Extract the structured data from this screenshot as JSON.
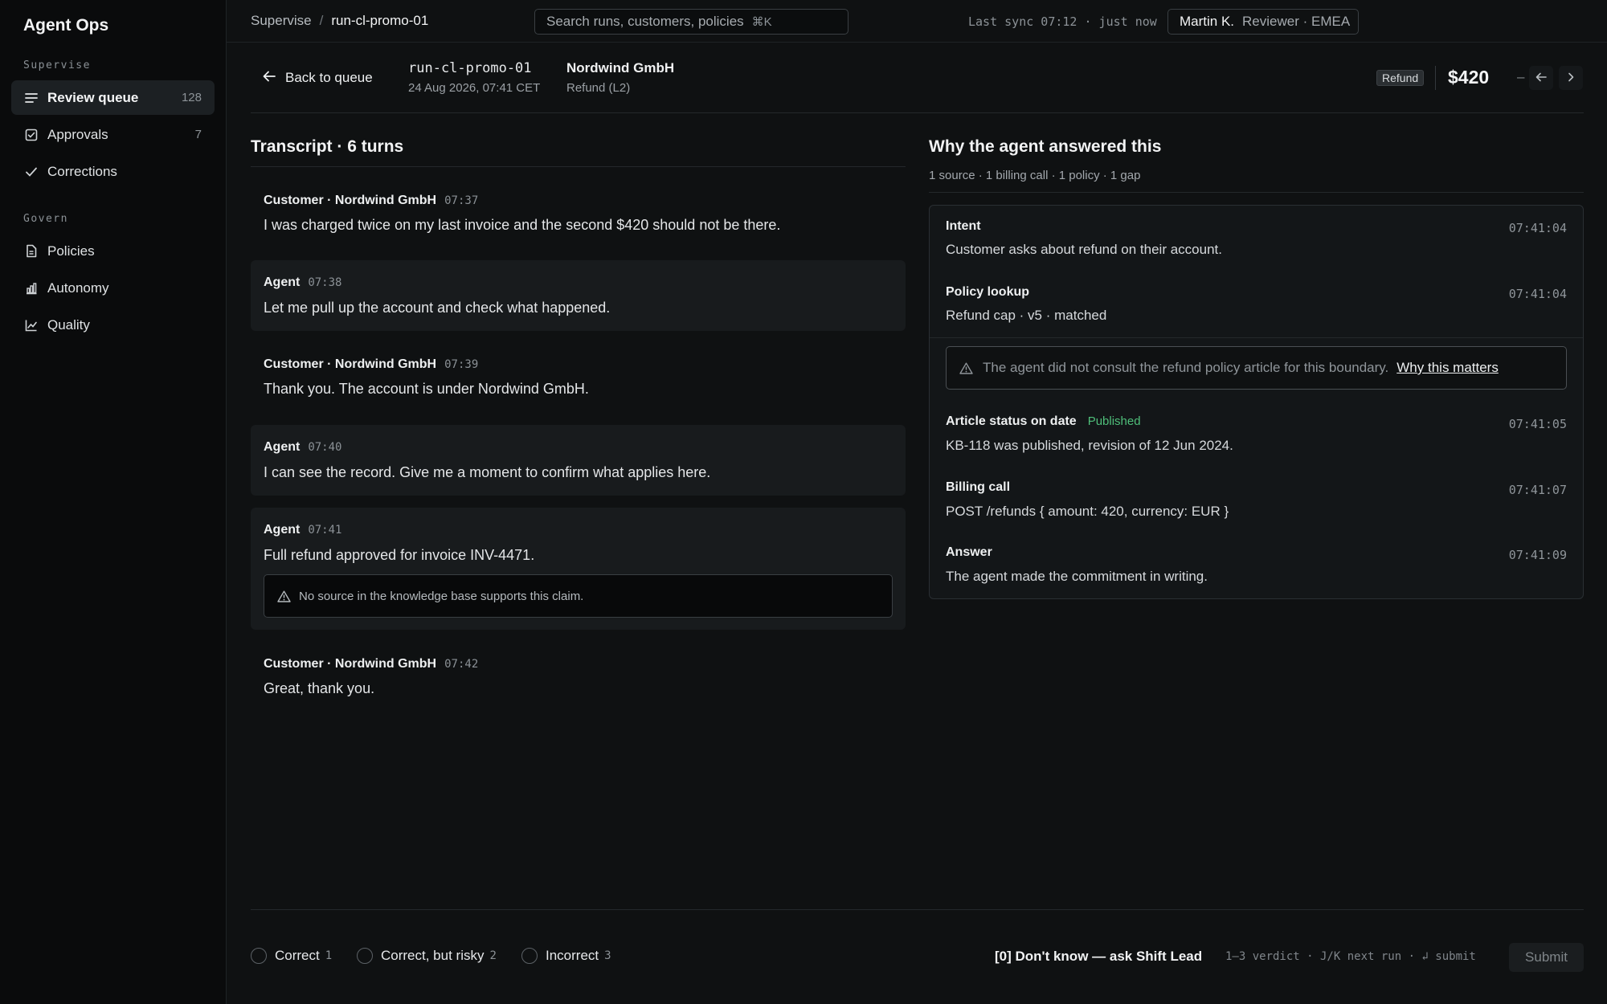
{
  "app": {
    "title": "Agent Ops"
  },
  "sidebar": {
    "sections": [
      {
        "label": "Supervise"
      },
      {
        "label": "Govern"
      }
    ],
    "items": [
      {
        "label": "Review queue",
        "count": "128",
        "icon": "list-icon"
      },
      {
        "label": "Approvals",
        "count": "7",
        "icon": "checkbox-icon"
      },
      {
        "label": "Corrections",
        "count": "",
        "icon": "check-icon"
      },
      {
        "label": "Policies",
        "count": "",
        "icon": "document-icon"
      },
      {
        "label": "Autonomy",
        "count": "",
        "icon": "bar-chart-icon"
      },
      {
        "label": "Quality",
        "count": "",
        "icon": "line-chart-icon"
      }
    ]
  },
  "topbar": {
    "breadcrumb": {
      "parent": "Supervise",
      "separator": "/",
      "current": "run-cl-promo-01"
    },
    "search": {
      "placeholder": "Search runs, customers, policies",
      "shortcut": "⌘K"
    },
    "sync": "Last sync 07:12 · just now",
    "user": {
      "name": "Martin K.",
      "role": "Reviewer · EMEA"
    }
  },
  "run": {
    "back_label": "Back to queue",
    "id": "run-cl-promo-01",
    "date": "24 Aug 2026, 07:41 CET",
    "customer": "Nordwind GmbH",
    "type": "Refund (L2)",
    "tag": "Refund",
    "amount": "$420",
    "dash": "–"
  },
  "transcript": {
    "title": "Transcript · 6 turns",
    "turns": [
      {
        "speaker": "Customer · Nordwind GmbH",
        "time": "07:37",
        "text": "I was charged twice on my last invoice and the second $420 should not be there."
      },
      {
        "speaker": "Agent",
        "time": "07:38",
        "text": "Let me pull up the account and check what happened."
      },
      {
        "speaker": "Customer · Nordwind GmbH",
        "time": "07:39",
        "text": "Thank you. The account is under Nordwind GmbH."
      },
      {
        "speaker": "Agent",
        "time": "07:40",
        "text": "I can see the record. Give me a moment to confirm what applies here."
      },
      {
        "speaker": "Agent",
        "time": "07:41",
        "text": "Full refund approved for invoice INV-4471.",
        "warning": "No source in the knowledge base supports this claim."
      },
      {
        "speaker": "Customer · Nordwind GmbH",
        "time": "07:42",
        "text": "Great, thank you."
      }
    ]
  },
  "why": {
    "title": "Why the agent answered this",
    "summary": "1 source · 1 billing call · 1 policy · 1 gap",
    "steps": [
      {
        "title": "Intent",
        "time": "07:41:04",
        "body": "Customer asks about refund on their account."
      },
      {
        "title": "Policy lookup",
        "time": "07:41:04",
        "body": "Refund cap · v5 · matched"
      },
      {
        "title": "Article status on date",
        "status": "Published",
        "time": "07:41:05",
        "body": "KB-118 was published, revision of 12 Jun 2024."
      },
      {
        "title": "Billing call",
        "time": "07:41:07",
        "body": "POST /refunds { amount: 420, currency: EUR }"
      },
      {
        "title": "Answer",
        "time": "07:41:09",
        "body": "The agent made the commitment in writing."
      }
    ],
    "gap": {
      "text": "The agent did not consult the refund policy article for this boundary.",
      "link": "Why this matters"
    }
  },
  "footer": {
    "verdicts": [
      {
        "label": "Correct",
        "key": "1"
      },
      {
        "label": "Correct, but risky",
        "key": "2"
      },
      {
        "label": "Incorrect",
        "key": "3"
      }
    ],
    "dont_know": "[0] Don't know — ask Shift Lead",
    "hints": "1–3 verdict · J/K next run · ↲ submit",
    "submit": "Submit"
  },
  "colors": {
    "published": "#4fbf7a",
    "background": "#0f1112",
    "sidebar": "#0a0b0c"
  }
}
